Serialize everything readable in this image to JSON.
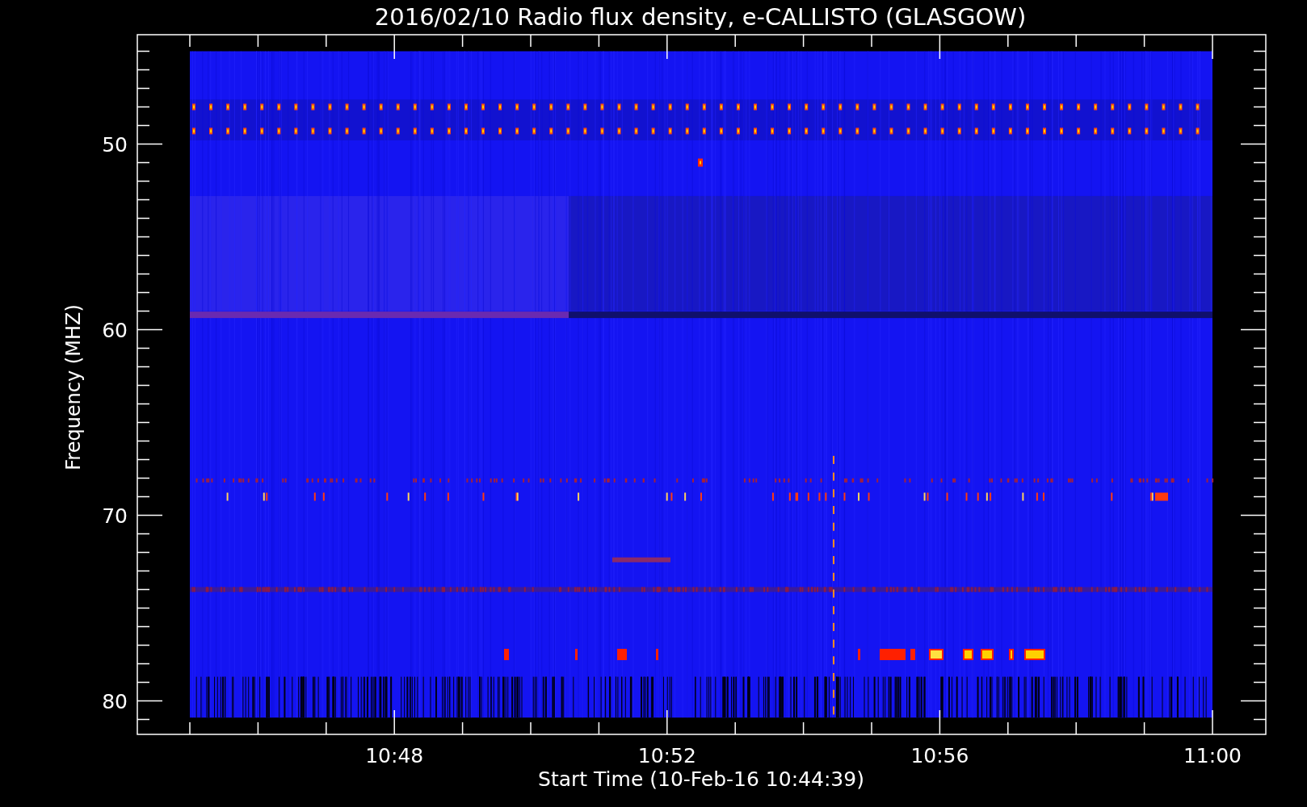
{
  "title": "2016/02/10  Radio flux density, e-CALLISTO (GLASGOW)",
  "y_axis": {
    "label": "Frequency (MHZ)",
    "ticks": [
      "50",
      "60",
      "70",
      "80"
    ]
  },
  "x_axis": {
    "label": "Start Time (10-Feb-16 10:44:39)",
    "ticks": [
      "10:48",
      "10:52",
      "10:56",
      "11:00"
    ]
  }
}
